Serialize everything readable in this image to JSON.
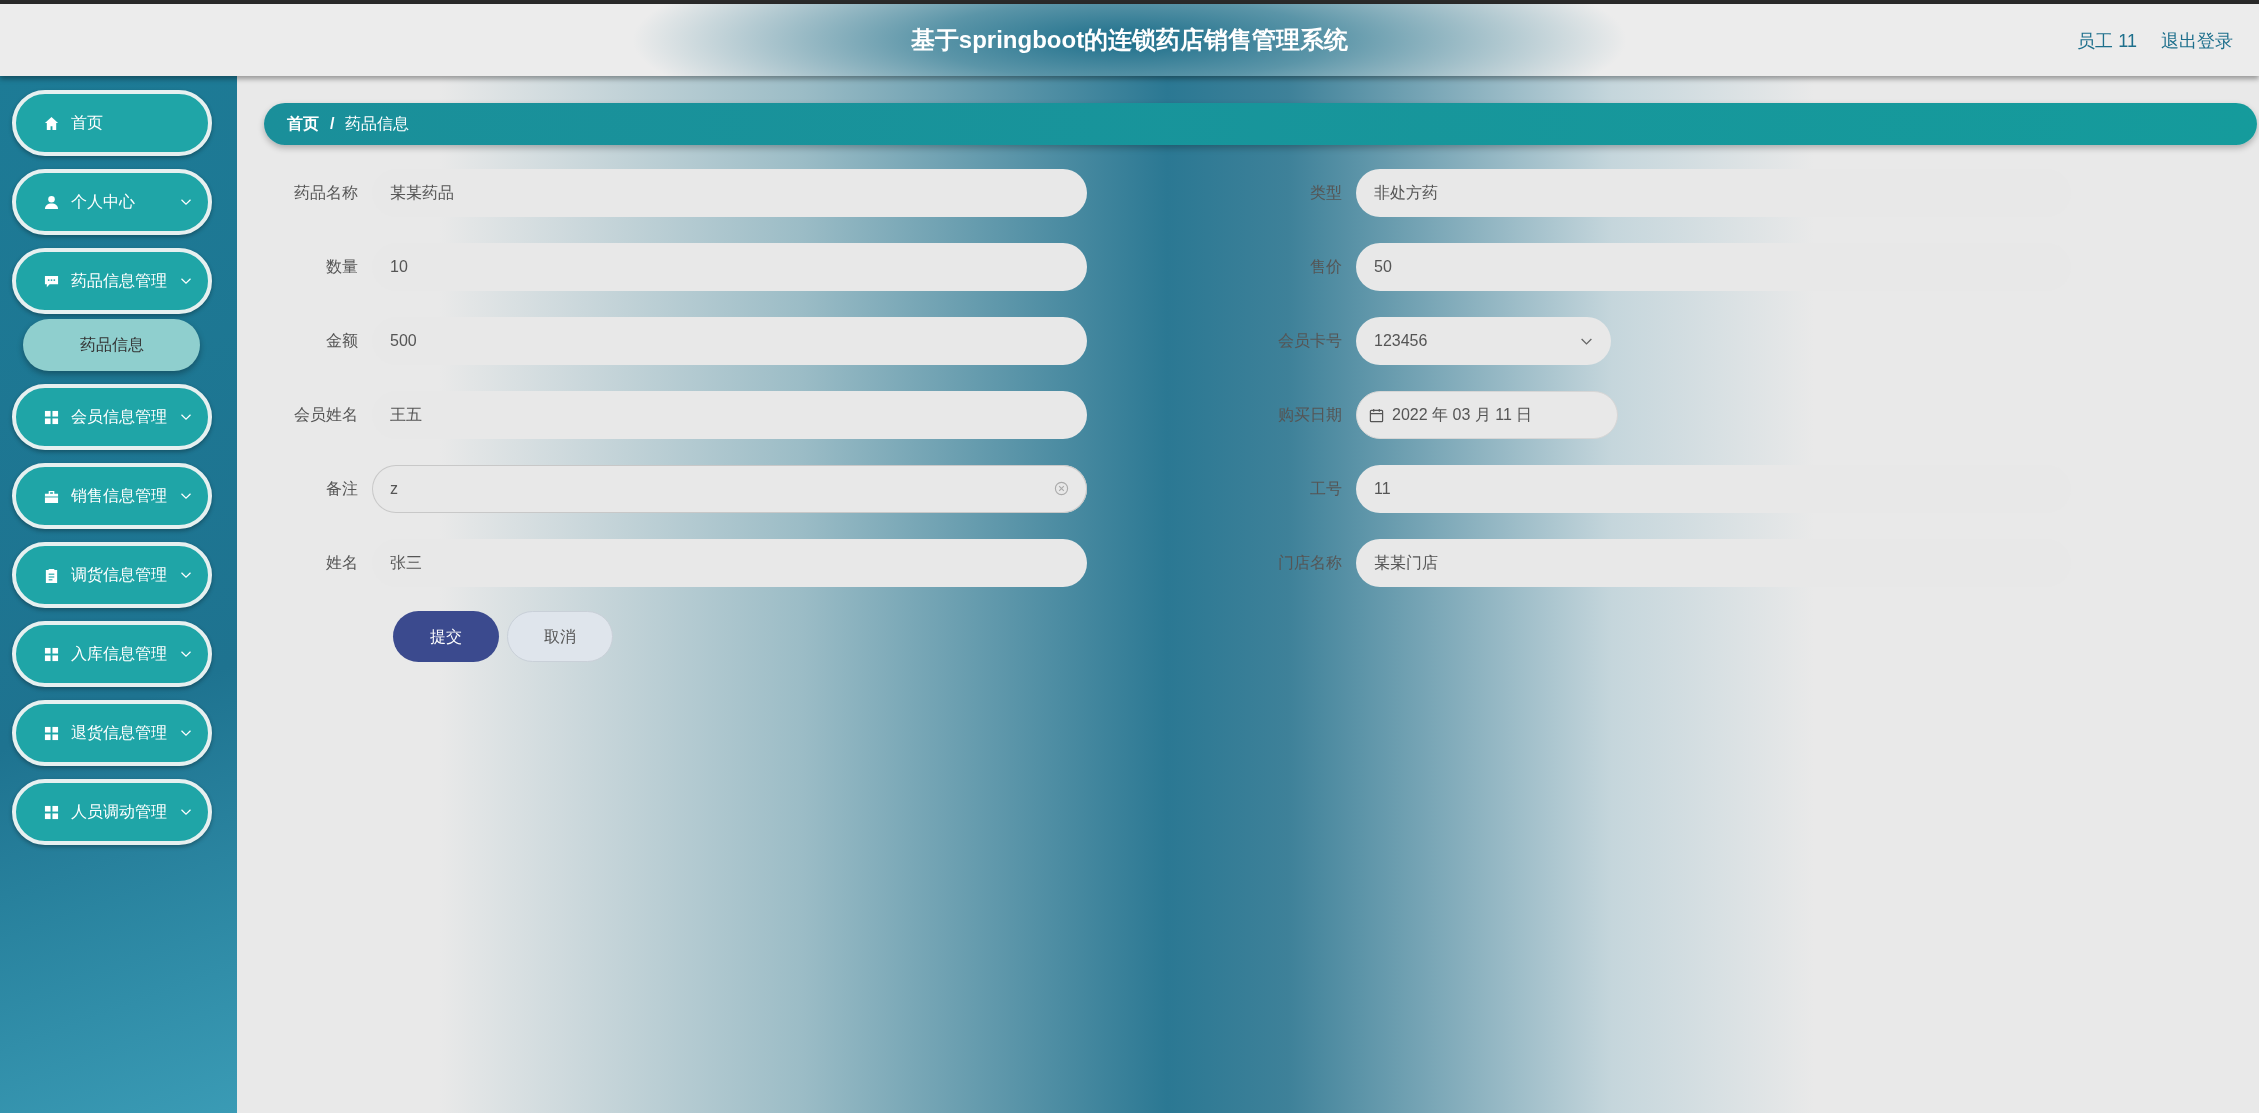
{
  "header": {
    "title": "基于springboot的连锁药店销售管理系统",
    "user": "员工 11",
    "logout": "退出登录"
  },
  "sidebar": {
    "items": [
      {
        "label": "首页",
        "expandable": false
      },
      {
        "label": "个人中心",
        "expandable": true,
        "expanded": false
      },
      {
        "label": "药品信息管理",
        "expandable": true,
        "expanded": true,
        "children": [
          {
            "label": "药品信息"
          }
        ]
      },
      {
        "label": "会员信息管理",
        "expandable": true,
        "expanded": false
      },
      {
        "label": "销售信息管理",
        "expandable": true,
        "expanded": false
      },
      {
        "label": "调货信息管理",
        "expandable": true,
        "expanded": false
      },
      {
        "label": "入库信息管理",
        "expandable": true,
        "expanded": false
      },
      {
        "label": "退货信息管理",
        "expandable": true,
        "expanded": false
      },
      {
        "label": "人员调动管理",
        "expandable": true,
        "expanded": false
      }
    ]
  },
  "breadcrumb": {
    "items": [
      "首页",
      "药品信息"
    ],
    "separator": "/"
  },
  "form": {
    "fields": [
      {
        "label": "药品名称",
        "value": "某某药品",
        "kind": "text",
        "focused": false
      },
      {
        "label": "类型",
        "value": "非处方药",
        "kind": "text",
        "focused": false
      },
      {
        "label": "数量",
        "value": "10",
        "kind": "text",
        "focused": false
      },
      {
        "label": "售价",
        "value": "50",
        "kind": "text",
        "focused": false
      },
      {
        "label": "金额",
        "value": "500",
        "kind": "text",
        "focused": false
      },
      {
        "label": "会员卡号",
        "value": "123456",
        "kind": "select",
        "focused": false
      },
      {
        "label": "会员姓名",
        "value": "王五",
        "kind": "text",
        "focused": false
      },
      {
        "label": "购买日期",
        "value": "2022 年 03 月 11 日",
        "kind": "date",
        "focused": false
      },
      {
        "label": "备注",
        "value": "z",
        "kind": "text",
        "focused": true
      },
      {
        "label": "工号",
        "value": "11",
        "kind": "text",
        "focused": false
      },
      {
        "label": "姓名",
        "value": "张三",
        "kind": "text",
        "focused": false
      },
      {
        "label": "门店名称",
        "value": "某某门店",
        "kind": "text",
        "focused": false
      }
    ],
    "buttons": [
      {
        "label": "提交",
        "kind": "primary"
      },
      {
        "label": "取消",
        "kind": "secondary"
      }
    ]
  }
}
